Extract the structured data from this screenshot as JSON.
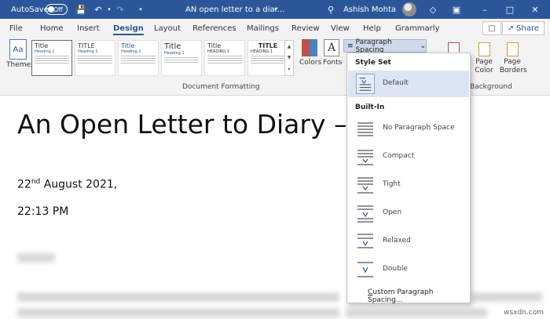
{
  "titlebar": {
    "autosave_label": "AutoSave",
    "autosave_state": "Off",
    "document_title": "AN open letter to a diar...",
    "user_name": "Ashish Mohta"
  },
  "tabs": [
    "File",
    "Home",
    "Insert",
    "Design",
    "Layout",
    "References",
    "Mailings",
    "Review",
    "View",
    "Help",
    "Grammarly"
  ],
  "active_tab": "Design",
  "share_label": "Share",
  "ribbon": {
    "themes_label": "Themes",
    "style_thumbs": [
      {
        "title": "Title",
        "heading": "Heading 1"
      },
      {
        "title": "TITLE",
        "heading": "Heading 1"
      },
      {
        "title": "Title",
        "heading": "Heading 1"
      },
      {
        "title": "Title",
        "heading": "Heading 1"
      },
      {
        "title": "Title",
        "heading": "HEADING 1"
      },
      {
        "title": "TITLE",
        "heading": "HEADING 1"
      }
    ],
    "document_formatting_label": "Document Formatting",
    "colors_label": "Colors",
    "fonts_label": "Fonts",
    "paragraph_spacing_label": "Paragraph Spacing",
    "page_color_label": "Page\nColor",
    "page_borders_label": "Page\nBorders",
    "background_label": "Background"
  },
  "document": {
    "heading": "An Open Letter to Diary –",
    "date_day": "22",
    "date_suffix": "nd",
    "date_rest": " August 2021,",
    "time": "22:13 PM"
  },
  "dropdown": {
    "style_set_label": "Style Set",
    "built_in_label": "Built-In",
    "items": [
      {
        "label": "Default"
      },
      {
        "label": "No Paragraph Space"
      },
      {
        "label": "Compact"
      },
      {
        "label": "Tight"
      },
      {
        "label": "Open"
      },
      {
        "label": "Relaxed"
      },
      {
        "label": "Double"
      }
    ],
    "custom_prefix": "C",
    "custom_rest": "ustom Paragraph Spacing..."
  },
  "watermark": "wsxdn.com",
  "colors": {
    "titlebar": "#2b579a",
    "accent": "#2b579a",
    "selected_item": "#dbe5f3"
  }
}
